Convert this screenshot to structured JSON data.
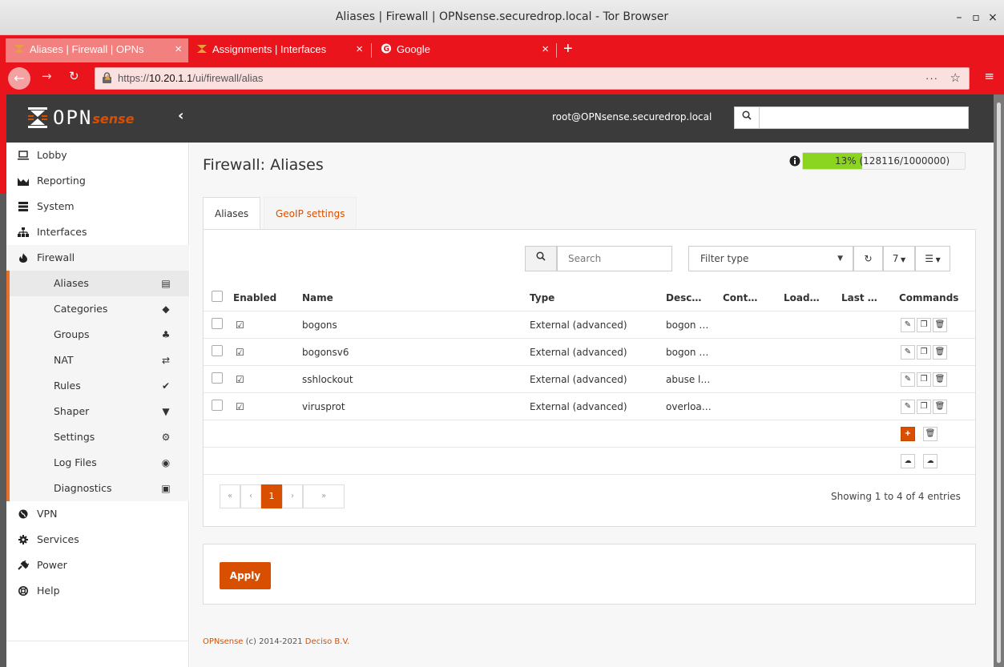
{
  "window": {
    "title": "Aliases | Firewall | OPNsense.securedrop.local - Tor Browser",
    "minimize": "–",
    "maximize": "▫",
    "close": "×"
  },
  "browser_tabs": [
    {
      "label": "Aliases | Firewall | OPNs",
      "active": true,
      "close": "×"
    },
    {
      "label": "Assignments | Interfaces",
      "active": false,
      "close": "×"
    },
    {
      "label": "Google",
      "active": false,
      "close": "×"
    }
  ],
  "new_tab": "+",
  "url": {
    "prefix": "https://",
    "host": "10.20.1.1",
    "path": "/ui/firewall/alias",
    "more": "···",
    "star": "☆",
    "menu": "≡"
  },
  "topnav": {
    "logo_opn": "OPN",
    "logo_sense": "sense",
    "collapse": "‹",
    "user": "root@OPNsense.securedrop.local"
  },
  "sidebar": {
    "top": [
      {
        "label": "Lobby",
        "icon": "laptop-icon"
      },
      {
        "label": "Reporting",
        "icon": "area-chart-icon"
      },
      {
        "label": "System",
        "icon": "server-icon"
      },
      {
        "label": "Interfaces",
        "icon": "sitemap-icon"
      },
      {
        "label": "Firewall",
        "icon": "fire-icon"
      }
    ],
    "firewall_sub": [
      {
        "label": "Aliases",
        "glyph": "▤"
      },
      {
        "label": "Categories",
        "glyph": "◆"
      },
      {
        "label": "Groups",
        "glyph": "♣"
      },
      {
        "label": "NAT",
        "glyph": "⇄"
      },
      {
        "label": "Rules",
        "glyph": "✔"
      },
      {
        "label": "Shaper",
        "glyph": "▼"
      },
      {
        "label": "Settings",
        "glyph": "⚙"
      },
      {
        "label": "Log Files",
        "glyph": "◉"
      },
      {
        "label": "Diagnostics",
        "glyph": "▣"
      }
    ],
    "bottom": [
      {
        "label": "VPN",
        "icon": "globe-icon"
      },
      {
        "label": "Services",
        "icon": "cog-icon"
      },
      {
        "label": "Power",
        "icon": "plug-icon"
      },
      {
        "label": "Help",
        "icon": "lifebuoy-icon"
      }
    ]
  },
  "page": {
    "title": "Firewall: Aliases",
    "usage_text": "13% (128116/1000000)",
    "usage_fraction": 0.13,
    "tabs": [
      "Aliases",
      "GeoIP settings"
    ],
    "search_placeholder": "Search",
    "filter_type": "Filter type",
    "rows_per_page": "7",
    "columns": [
      "Enabled",
      "Name",
      "Type",
      "Desc…",
      "Cont…",
      "Load…",
      "Last …",
      "Commands"
    ],
    "rows": [
      {
        "name": "bogons",
        "type": "External (advanced)",
        "desc": "bogon …"
      },
      {
        "name": "bogonsv6",
        "type": "External (advanced)",
        "desc": "bogon …"
      },
      {
        "name": "sshlockout",
        "type": "External (advanced)",
        "desc": "abuse l…"
      },
      {
        "name": "virusprot",
        "type": "External (advanced)",
        "desc": "overloa…"
      }
    ],
    "pager": {
      "first": "«",
      "prev": "‹",
      "current": "1",
      "next": "›",
      "last": "»"
    },
    "showing": "Showing 1 to 4 of 4 entries",
    "apply": "Apply"
  },
  "footer": {
    "brand": "OPNsense",
    "middle": " (c) 2014-2021 ",
    "company": "Deciso B.V."
  },
  "colors": {
    "accent": "#d94f00",
    "tor_red": "#e9141c",
    "topnav": "#3b3b3b",
    "usage_green": "#8bd41f"
  }
}
